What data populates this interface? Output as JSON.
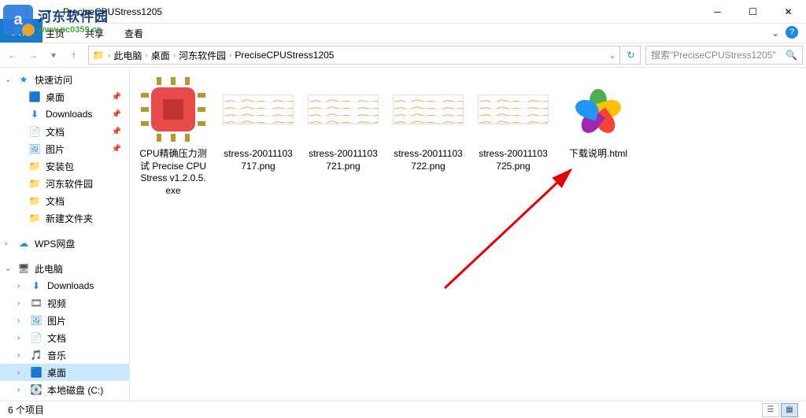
{
  "window": {
    "title": "PreciseCPUStress1205"
  },
  "ribbon": {
    "file": "文件",
    "tabs": [
      "主页",
      "共享",
      "查看"
    ]
  },
  "breadcrumbs": [
    "此电脑",
    "桌面",
    "河东软件园",
    "PreciseCPUStress1205"
  ],
  "search": {
    "placeholder": "搜索\"PreciseCPUStress1205\""
  },
  "sidebar": {
    "quick": "快速访问",
    "quick_items": [
      {
        "label": "桌面",
        "icon": "desktop",
        "pinned": true
      },
      {
        "label": "Downloads",
        "icon": "dl",
        "pinned": true
      },
      {
        "label": "文档",
        "icon": "doc",
        "pinned": true
      },
      {
        "label": "图片",
        "icon": "pic",
        "pinned": true
      },
      {
        "label": "安装包",
        "icon": "folder"
      },
      {
        "label": "河东软件园",
        "icon": "folder"
      },
      {
        "label": "文档",
        "icon": "folder"
      },
      {
        "label": "新建文件夹",
        "icon": "folder"
      }
    ],
    "wps": "WPS网盘",
    "this_pc": "此电脑",
    "pc_items": [
      {
        "label": "Downloads",
        "icon": "dl"
      },
      {
        "label": "视频",
        "icon": "video"
      },
      {
        "label": "图片",
        "icon": "pic"
      },
      {
        "label": "文档",
        "icon": "doc"
      },
      {
        "label": "音乐",
        "icon": "music"
      },
      {
        "label": "桌面",
        "icon": "desktop",
        "sel": true
      },
      {
        "label": "本地磁盘 (C:)",
        "icon": "drive"
      }
    ]
  },
  "files": [
    {
      "name": "CPU精确压力测试 Precise CPU Stress v1.2.0.5.exe",
      "type": "exe"
    },
    {
      "name": "stress-20011103717.png",
      "type": "png"
    },
    {
      "name": "stress-20011103721.png",
      "type": "png"
    },
    {
      "name": "stress-20011103722.png",
      "type": "png"
    },
    {
      "name": "stress-20011103725.png",
      "type": "png"
    },
    {
      "name": "下载说明.html",
      "type": "html"
    }
  ],
  "status": {
    "count": "6 个项目"
  },
  "watermark": {
    "cn": "河东软件园",
    "en": "www.pc0359.cn"
  }
}
